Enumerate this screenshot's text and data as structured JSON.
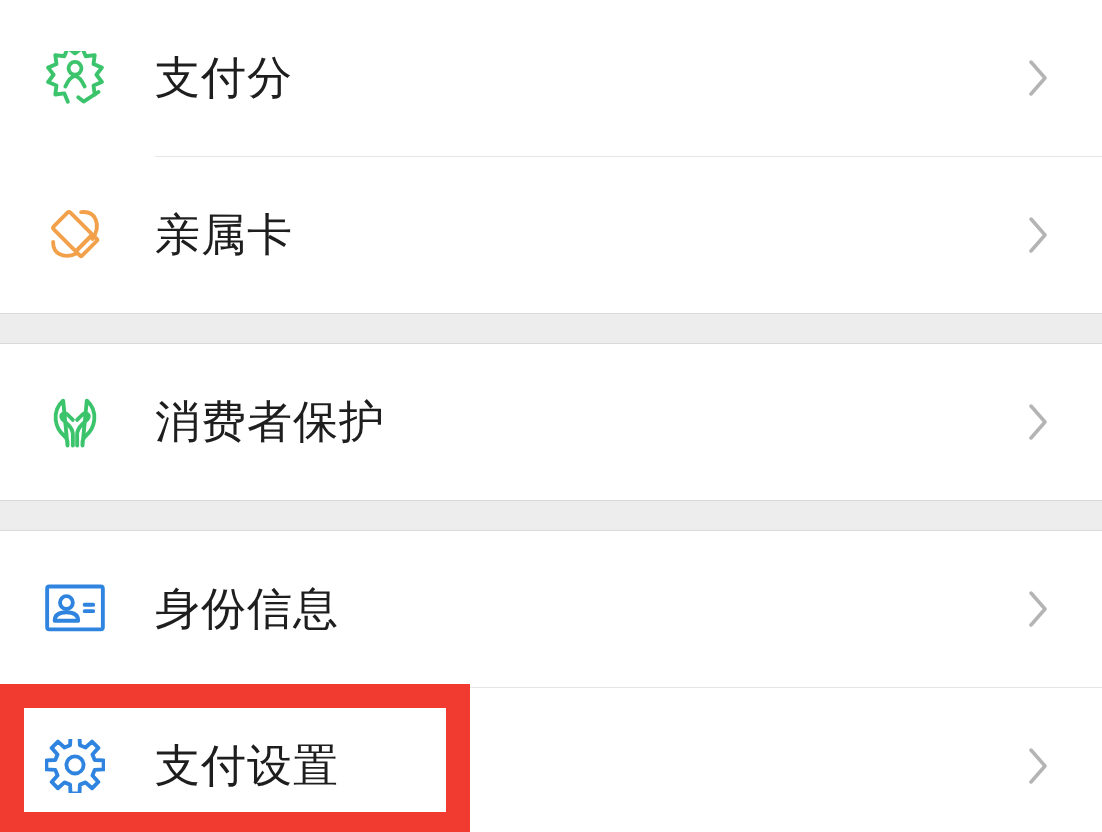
{
  "groups": [
    {
      "items": [
        {
          "label": "支付分",
          "highlighted": false
        },
        {
          "label": "亲属卡",
          "highlighted": false
        }
      ]
    },
    {
      "items": [
        {
          "label": "消费者保护",
          "highlighted": false
        }
      ]
    },
    {
      "items": [
        {
          "label": "身份信息",
          "highlighted": false
        },
        {
          "label": "支付设置",
          "highlighted": true
        }
      ]
    }
  ]
}
